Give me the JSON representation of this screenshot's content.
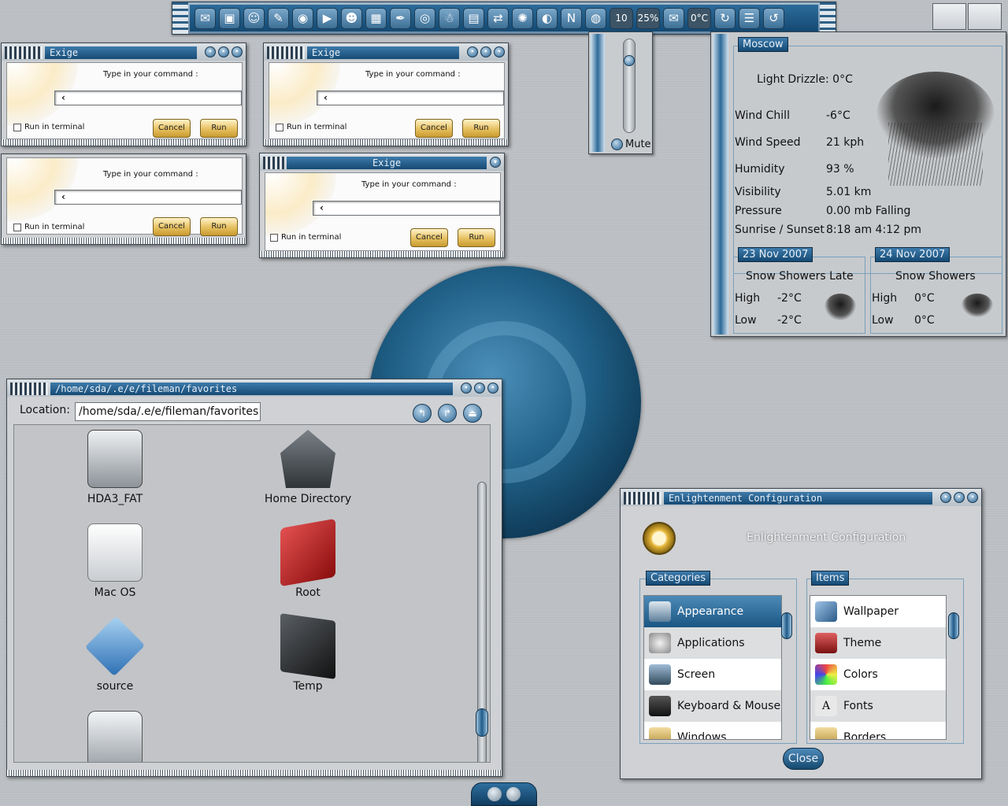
{
  "shelf": {
    "icons": [
      "mail-client-icon",
      "terminal-icon",
      "tux-icon",
      "pencil-icon",
      "camera-icon",
      "video-icon",
      "game-icon",
      "photo-icon",
      "ink-icon",
      "blender-icon",
      "linux-icon",
      "image-viewer-icon",
      "network-icon",
      "globe-icon",
      "browser-icon",
      "netscape-icon",
      "disc-icon"
    ],
    "battery_label": "10",
    "cpu_label": "25%",
    "temp_label": "0°C"
  },
  "exige": {
    "title": "Exige",
    "prompt": "Type in your command :",
    "input_value": "",
    "terminal_label": "Run in terminal",
    "cancel_label": "Cancel",
    "run_label": "Run"
  },
  "volume": {
    "mute_label": "Mute",
    "level": 0.8
  },
  "weather": {
    "city": "Moscow",
    "condition": "Light Drizzle: 0°C",
    "rows": [
      {
        "label": "Wind Chill",
        "value": "-6°C"
      },
      {
        "label": "Wind Speed",
        "value": "21 kph"
      },
      {
        "label": "Humidity",
        "value": "93 %"
      },
      {
        "label": "Visibility",
        "value": "5.01 km"
      },
      {
        "label": "Pressure",
        "value": "0.00 mb Falling"
      },
      {
        "label": "Sunrise / Sunset",
        "value": "8:18 am 4:12 pm"
      }
    ],
    "forecast": [
      {
        "date": "23 Nov 2007",
        "desc": "Snow Showers Late",
        "high_label": "High",
        "high": "-2°C",
        "low_label": "Low",
        "low": "-2°C"
      },
      {
        "date": "24 Nov 2007",
        "desc": "Snow Showers",
        "high_label": "High",
        "high": "0°C",
        "low_label": "Low",
        "low": "0°C"
      }
    ]
  },
  "fileman": {
    "title": "/home/sda/.e/e/fileman/favorites",
    "location_label": "Location:",
    "location_value": "/home/sda/.e/e/fileman/favorites",
    "items": [
      {
        "name": "HDA3_FAT",
        "icon": "harddisk-icon"
      },
      {
        "name": "Home Directory",
        "icon": "home-icon"
      },
      {
        "name": "Mac OS",
        "icon": "drive-icon"
      },
      {
        "name": "Root",
        "icon": "root-icon"
      },
      {
        "name": "source",
        "icon": "source-icon"
      },
      {
        "name": "Temp",
        "icon": "folder-icon"
      },
      {
        "name": "",
        "icon": "camcorder-icon"
      }
    ]
  },
  "config": {
    "title": "Enlightenment Configuration",
    "heading": "Enlightenment Configuration",
    "categories_label": "Categories",
    "items_label": "Items",
    "categories": [
      "Appearance",
      "Applications",
      "Screen",
      "Keyboard & Mouse",
      "Windows"
    ],
    "items": [
      "Wallpaper",
      "Theme",
      "Colors",
      "Fonts",
      "Borders"
    ],
    "close_label": "Close"
  },
  "colors": {
    "accent": "#1b5683",
    "gold": "#e6c060"
  }
}
